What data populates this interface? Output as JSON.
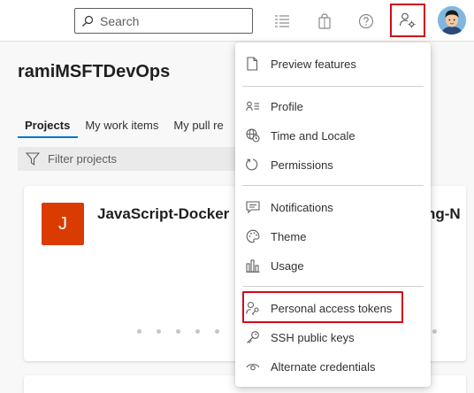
{
  "search": {
    "placeholder": "Search"
  },
  "header": {
    "icons": [
      "task-list-icon",
      "shopping-bag-icon",
      "help-icon",
      "user-settings-icon"
    ]
  },
  "page": {
    "org_title": "ramiMSFTDevOps",
    "tabs": [
      {
        "label": "Projects",
        "active": true
      },
      {
        "label": "My work items",
        "active": false
      },
      {
        "label": "My pull re",
        "active": false
      }
    ],
    "filter_placeholder": "Filter projects"
  },
  "project_card": {
    "initial": "J",
    "name": "JavaScript-Docker",
    "name_right_fragment": "ng-N",
    "tile_color": "#da3b01"
  },
  "menu": {
    "items": [
      {
        "label": "Preview features",
        "icon": "page-icon"
      },
      {
        "label": "Profile",
        "icon": "profile-card-icon"
      },
      {
        "label": "Time and Locale",
        "icon": "globe-clock-icon"
      },
      {
        "label": "Permissions",
        "icon": "refresh-circle-icon"
      },
      {
        "label": "Notifications",
        "icon": "chat-icon"
      },
      {
        "label": "Theme",
        "icon": "palette-icon"
      },
      {
        "label": "Usage",
        "icon": "bar-chart-icon"
      },
      {
        "label": "Personal access tokens",
        "icon": "person-key-icon"
      },
      {
        "label": "SSH public keys",
        "icon": "key-icon"
      },
      {
        "label": "Alternate credentials",
        "icon": "eye-icon"
      }
    ]
  },
  "colors": {
    "highlight": "#d10a1a",
    "accent": "#0078d4"
  }
}
